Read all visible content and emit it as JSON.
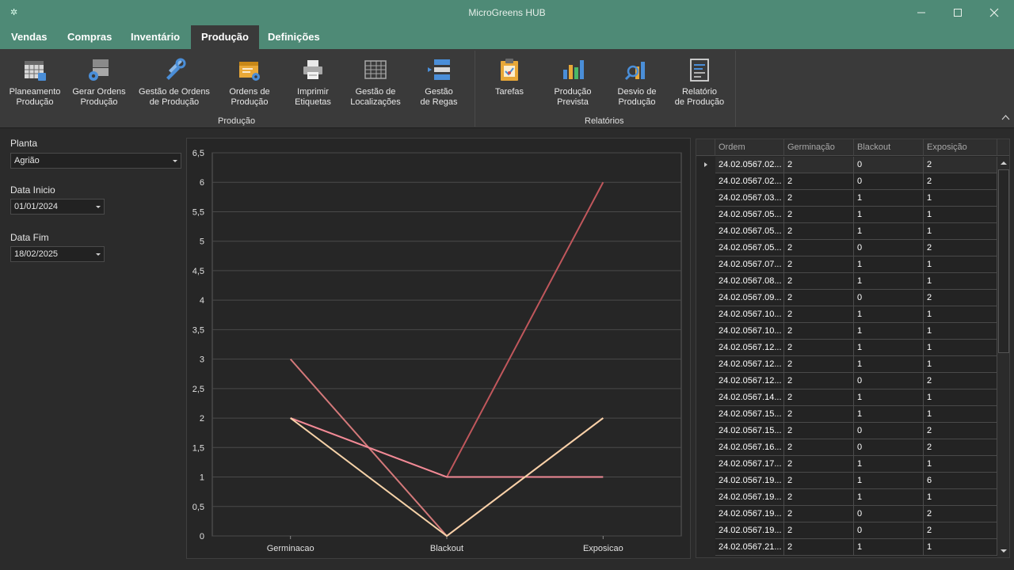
{
  "window": {
    "title": "MicroGreens HUB"
  },
  "tabs": [
    {
      "label": "Vendas"
    },
    {
      "label": "Compras"
    },
    {
      "label": "Inventário"
    },
    {
      "label": "Produção"
    },
    {
      "label": "Definições"
    }
  ],
  "active_tab": "Produção",
  "ribbon": {
    "groups": [
      {
        "label": "Produção"
      },
      {
        "label": "Relatórios"
      }
    ],
    "buttons": [
      {
        "label": "Planeamento\nProdução",
        "icon": "planning-grid-icon"
      },
      {
        "label": "Gerar Ordens\nProdução",
        "icon": "generate-orders-icon"
      },
      {
        "label": "Gestão de Ordens\nde Produção",
        "icon": "tools-icon"
      },
      {
        "label": "Ordens de\nProdução",
        "icon": "orders-folder-icon"
      },
      {
        "label": "Imprimir\nEtiquetas",
        "icon": "printer-icon"
      },
      {
        "label": "Gestão de\nLocalizações",
        "icon": "locations-grid-icon"
      },
      {
        "label": "Gestão\nde Regas",
        "icon": "watering-list-icon"
      },
      {
        "label": "Tarefas",
        "icon": "clipboard-icon"
      },
      {
        "label": "Produção\nPrevista",
        "icon": "bar-chart-icon"
      },
      {
        "label": "Desvio de\nProdução",
        "icon": "chart-magnifier-icon"
      },
      {
        "label": "Relatório\nde Produção",
        "icon": "report-icon"
      }
    ]
  },
  "filters": {
    "plant_label": "Planta",
    "plant_value": "Agrião",
    "start_label": "Data Inicio",
    "start_value": "01/01/2024",
    "end_label": "Data Fim",
    "end_value": "18/02/2025"
  },
  "chart_data": {
    "type": "line",
    "categories": [
      "Germinacao",
      "Blackout",
      "Exposicao"
    ],
    "ylim": [
      0,
      6.5
    ],
    "y_ticks": [
      "0",
      "0,5",
      "1",
      "1,5",
      "2",
      "2,5",
      "3",
      "3,5",
      "4",
      "4,5",
      "5",
      "5,5",
      "6",
      "6,5"
    ],
    "grid": true,
    "series": [
      {
        "values": [
          2,
          1,
          6
        ],
        "color": "#c0575c"
      },
      {
        "values": [
          3,
          0,
          2
        ],
        "color": "#d4797a"
      },
      {
        "values": [
          2,
          1,
          1
        ],
        "color": "#f08a96"
      },
      {
        "values": [
          2,
          0,
          2
        ],
        "color": "#f6d2a8"
      }
    ]
  },
  "grid": {
    "columns": [
      "Ordem",
      "Germinação",
      "Blackout",
      "Exposição"
    ],
    "rows": [
      [
        "24.02.0567.02...",
        "2",
        "0",
        "2"
      ],
      [
        "24.02.0567.02...",
        "2",
        "0",
        "2"
      ],
      [
        "24.02.0567.03...",
        "2",
        "1",
        "1"
      ],
      [
        "24.02.0567.05...",
        "2",
        "1",
        "1"
      ],
      [
        "24.02.0567.05...",
        "2",
        "1",
        "1"
      ],
      [
        "24.02.0567.05...",
        "2",
        "0",
        "2"
      ],
      [
        "24.02.0567.07...",
        "2",
        "1",
        "1"
      ],
      [
        "24.02.0567.08...",
        "2",
        "1",
        "1"
      ],
      [
        "24.02.0567.09...",
        "2",
        "0",
        "2"
      ],
      [
        "24.02.0567.10...",
        "2",
        "1",
        "1"
      ],
      [
        "24.02.0567.10...",
        "2",
        "1",
        "1"
      ],
      [
        "24.02.0567.12...",
        "2",
        "1",
        "1"
      ],
      [
        "24.02.0567.12...",
        "2",
        "1",
        "1"
      ],
      [
        "24.02.0567.12...",
        "2",
        "0",
        "2"
      ],
      [
        "24.02.0567.14...",
        "2",
        "1",
        "1"
      ],
      [
        "24.02.0567.15...",
        "2",
        "1",
        "1"
      ],
      [
        "24.02.0567.15...",
        "2",
        "0",
        "2"
      ],
      [
        "24.02.0567.16...",
        "2",
        "0",
        "2"
      ],
      [
        "24.02.0567.17...",
        "2",
        "1",
        "1"
      ],
      [
        "24.02.0567.19...",
        "2",
        "1",
        "6"
      ],
      [
        "24.02.0567.19...",
        "2",
        "1",
        "1"
      ],
      [
        "24.02.0567.19...",
        "2",
        "0",
        "2"
      ],
      [
        "24.02.0567.19...",
        "2",
        "0",
        "2"
      ],
      [
        "24.02.0567.21...",
        "2",
        "1",
        "1"
      ]
    ]
  }
}
